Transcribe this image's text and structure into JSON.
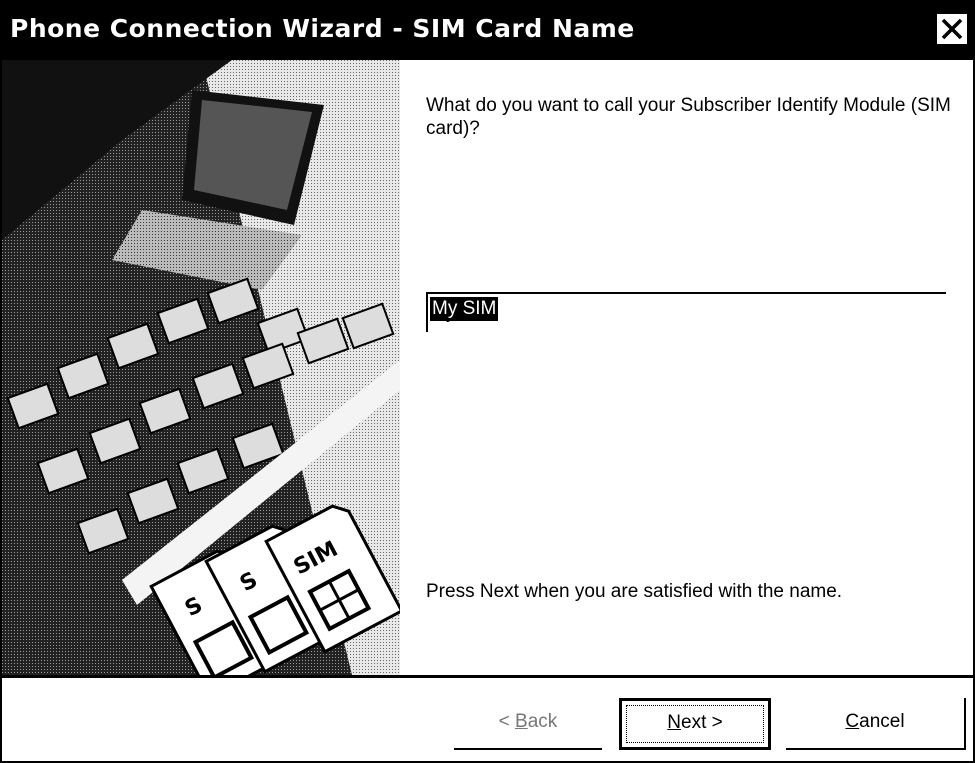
{
  "window": {
    "title": "Phone Connection Wizard - SIM Card Name",
    "close_icon": "close-x-icon"
  },
  "content": {
    "question": "What do you want to call your Subscriber Identify Module (SIM card)?",
    "sim_name_value": "My SIM",
    "hint": "Press Next when you are satisfied with the name."
  },
  "artwork": {
    "card_label": "SIM",
    "card_label_short": "S"
  },
  "buttons": {
    "back": {
      "mnemonic": "B",
      "rest": "ack",
      "prefix": "< ",
      "enabled": false
    },
    "next": {
      "mnemonic": "N",
      "rest": "ext",
      "suffix": " >"
    },
    "cancel": {
      "mnemonic": "C",
      "rest": "ancel"
    }
  }
}
